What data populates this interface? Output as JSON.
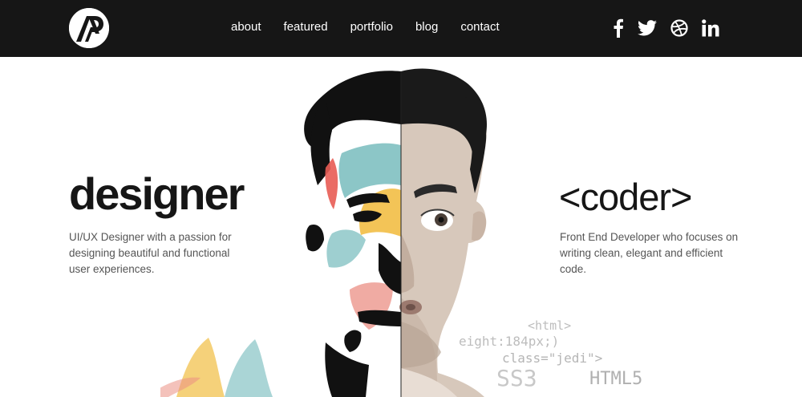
{
  "header": {
    "nav": [
      {
        "label": "about"
      },
      {
        "label": "featured"
      },
      {
        "label": "portfolio"
      },
      {
        "label": "blog"
      },
      {
        "label": "contact"
      }
    ],
    "social": [
      "facebook-icon",
      "twitter-icon",
      "dribbble-icon",
      "linkedin-icon"
    ],
    "colors": {
      "bar": "#161616",
      "text": "#ffffff"
    }
  },
  "hero": {
    "left": {
      "title": "designer",
      "text": "UI/UX Designer with a passion for designing beautiful and functional user experiences."
    },
    "right": {
      "title": "<coder>",
      "text": "Front End Developer who focuses on writing clean, elegant and efficient code."
    },
    "code_snippets": [
      "<html>",
      "eight:184px;)",
      "class=\"jedi\">",
      "SS3",
      "HTML5"
    ]
  }
}
